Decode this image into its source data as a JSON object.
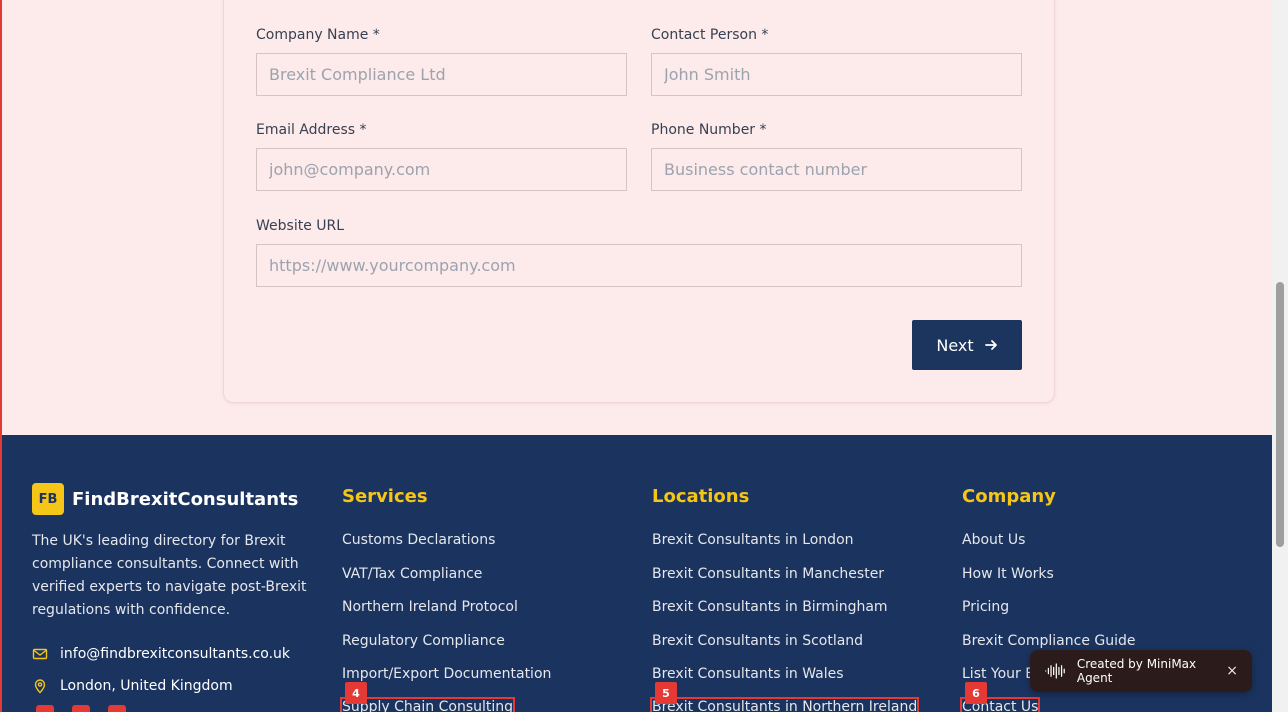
{
  "form": {
    "company_name": {
      "label": "Company Name *",
      "placeholder": "Brexit Compliance Ltd"
    },
    "contact_person": {
      "label": "Contact Person *",
      "placeholder": "John Smith"
    },
    "email": {
      "label": "Email Address *",
      "placeholder": "john@company.com"
    },
    "phone": {
      "label": "Phone Number *",
      "placeholder": "Business contact number"
    },
    "website": {
      "label": "Website URL",
      "placeholder": "https://www.yourcompany.com"
    },
    "next_label": "Next"
  },
  "footer": {
    "brand_logo": "FB",
    "brand_name": "FindBrexitConsultants",
    "brand_desc": "The UK's leading directory for Brexit compliance consultants. Connect with verified experts to navigate post-Brexit regulations with confidence.",
    "email": "info@findbrexitconsultants.co.uk",
    "location": "London, United Kingdom",
    "services": {
      "title": "Services",
      "items": [
        "Customs Declarations",
        "VAT/Tax Compliance",
        "Northern Ireland Protocol",
        "Regulatory Compliance",
        "Import/Export Documentation",
        "Supply Chain Consulting"
      ]
    },
    "locations": {
      "title": "Locations",
      "items": [
        "Brexit Consultants in London",
        "Brexit Consultants in Manchester",
        "Brexit Consultants in Birmingham",
        "Brexit Consultants in Scotland",
        "Brexit Consultants in Wales",
        "Brexit Consultants in Northern Ireland"
      ]
    },
    "company": {
      "title": "Company",
      "items": [
        "About Us",
        "How It Works",
        "Pricing",
        "Brexit Compliance Guide",
        "List Your Business",
        "Contact Us"
      ]
    },
    "badges": [
      "4",
      "5",
      "6"
    ]
  },
  "toast": {
    "text": "Created by MiniMax Agent",
    "close": "×"
  },
  "colors": {
    "navy": "#1b335f",
    "accent": "#f5c518",
    "highlight": "#e53935"
  }
}
